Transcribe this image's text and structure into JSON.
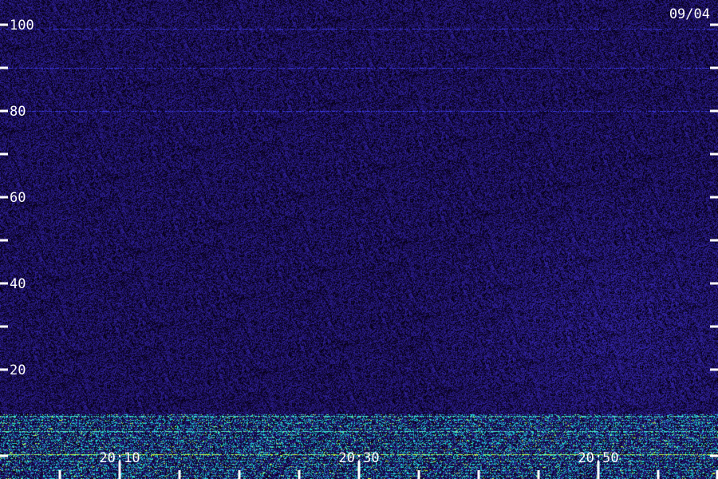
{
  "chart_data": {
    "type": "heatmap",
    "date_label": "09/04",
    "y_range": [
      0,
      100
    ],
    "y_major_ticks": [
      {
        "value": 20,
        "label": "20"
      },
      {
        "value": 40,
        "label": "40"
      },
      {
        "value": 60,
        "label": "60"
      },
      {
        "value": 80,
        "label": "80"
      },
      {
        "value": 100,
        "label": "100"
      }
    ],
    "y_minor_ticks": [
      0,
      30,
      50,
      70,
      90
    ],
    "x_range_minutes": [
      0,
      60
    ],
    "x_major_ticks": [
      {
        "minute": 10,
        "label": "20:10"
      },
      {
        "minute": 30,
        "label": "20:30"
      },
      {
        "minute": 50,
        "label": "20:50"
      }
    ],
    "x_minor_ticks": [
      5,
      15,
      20,
      25,
      35,
      40,
      45,
      55,
      60
    ],
    "colors": {
      "background": "#1c0d5a",
      "noise_low": "#0a0020",
      "noise_high": "#3a2cc0",
      "band": "#2af5d0",
      "band_hot": "#c8ff40",
      "axis": "#ffffff"
    }
  }
}
